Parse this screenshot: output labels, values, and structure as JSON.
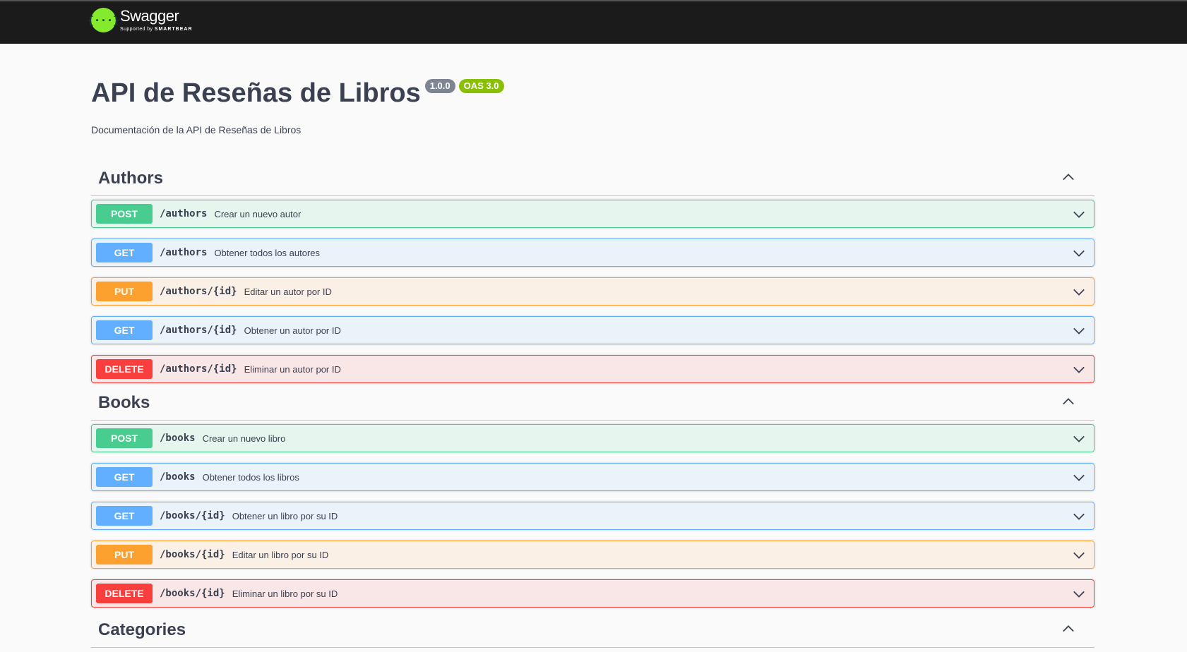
{
  "topbar": {
    "logo_glyph": "{···}",
    "brand_name": "Swagger",
    "brand_sub_prefix": "Supported by ",
    "brand_sub_strong": "SMARTBEAR"
  },
  "info": {
    "title": "API de Reseñas de Libros",
    "version": "1.0.0",
    "oas": "OAS 3.0",
    "description": "Documentación de la API de Reseñas de Libros"
  },
  "colors": {
    "post": "#49cc90",
    "get": "#61affe",
    "put": "#fca130",
    "delete": "#f93e3e",
    "topbar": "#1b1b1b",
    "logo": "#85ea2d"
  },
  "tags": [
    {
      "name": "Authors",
      "toggle_icon": "chevron-up-icon",
      "operations": [
        {
          "method": "POST",
          "path": "/authors",
          "summary": "Crear un nuevo autor"
        },
        {
          "method": "GET",
          "path": "/authors",
          "summary": "Obtener todos los autores"
        },
        {
          "method": "PUT",
          "path": "/authors/{id}",
          "summary": "Editar un autor por ID"
        },
        {
          "method": "GET",
          "path": "/authors/{id}",
          "summary": "Obtener un autor por ID"
        },
        {
          "method": "DELETE",
          "path": "/authors/{id}",
          "summary": "Eliminar un autor por ID"
        }
      ]
    },
    {
      "name": "Books",
      "toggle_icon": "chevron-up-icon",
      "operations": [
        {
          "method": "POST",
          "path": "/books",
          "summary": "Crear un nuevo libro"
        },
        {
          "method": "GET",
          "path": "/books",
          "summary": "Obtener todos los libros"
        },
        {
          "method": "GET",
          "path": "/books/{id}",
          "summary": "Obtener un libro por su ID"
        },
        {
          "method": "PUT",
          "path": "/books/{id}",
          "summary": "Editar un libro por su ID"
        },
        {
          "method": "DELETE",
          "path": "/books/{id}",
          "summary": "Eliminar un libro por su ID"
        }
      ]
    },
    {
      "name": "Categories",
      "toggle_icon": "chevron-up-icon",
      "operations": []
    }
  ]
}
